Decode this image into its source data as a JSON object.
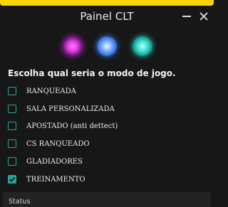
{
  "window": {
    "title": "Painel CLT"
  },
  "colors": {
    "accent_bar": "#ffd500",
    "checkbox": "#25a59c",
    "background": "#171717"
  },
  "orbs": [
    {
      "name": "magenta-orb-icon",
      "color": "#e040e8"
    },
    {
      "name": "blue-orb-icon",
      "color": "#2a63d8"
    },
    {
      "name": "teal-orb-icon",
      "color": "#45e3cf"
    }
  ],
  "prompt": "Escolha qual seria o modo de jogo.",
  "options": [
    {
      "label": "RANQUEADA",
      "checked": false
    },
    {
      "label": "SALA PERSONALIZADA",
      "checked": false
    },
    {
      "label": "APOSTADO (anti dettect)",
      "checked": false
    },
    {
      "label": "CS RANQUEADO",
      "checked": false
    },
    {
      "label": "GLADIADORES",
      "checked": false
    },
    {
      "label": "TREINAMENTO",
      "checked": true
    }
  ],
  "status": {
    "label": "Status"
  }
}
